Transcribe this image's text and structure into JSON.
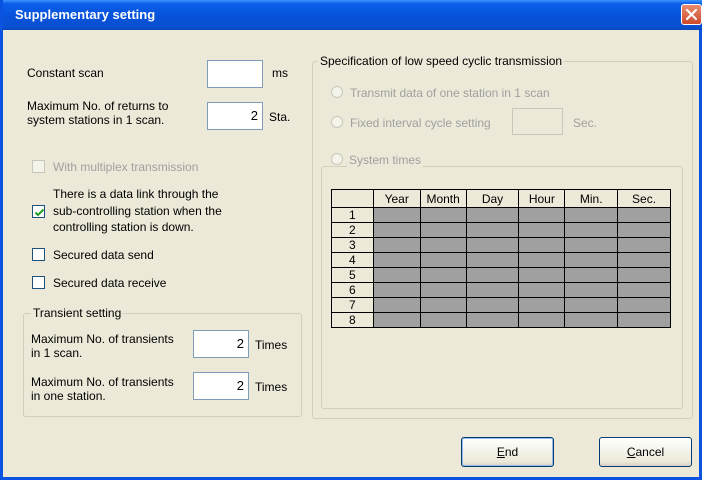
{
  "window": {
    "title": "Supplementary setting"
  },
  "constant_scan": {
    "label": "Constant scan",
    "value": "",
    "unit": "ms"
  },
  "max_returns": {
    "label_line1": "Maximum No. of returns to",
    "label_line2": "system stations in 1 scan.",
    "value": "2",
    "unit": "Sta."
  },
  "multiplex": {
    "label": "With multiplex transmission",
    "checked": false,
    "enabled": false
  },
  "data_link": {
    "label_line1": "There is a data link through the",
    "label_line2": "sub-controlling station when the",
    "label_line3": "controlling station is down.",
    "checked": true
  },
  "secured_send": {
    "label": "Secured data send",
    "checked": false
  },
  "secured_receive": {
    "label": "Secured data receive",
    "checked": false
  },
  "transient": {
    "group_title": "Transient setting",
    "per_scan": {
      "label_line1": "Maximum No. of transients",
      "label_line2": "in 1 scan.",
      "value": "2",
      "unit": "Times"
    },
    "per_station": {
      "label_line1": "Maximum No. of transients",
      "label_line2": "in one station.",
      "value": "2",
      "unit": "Times"
    }
  },
  "low_speed": {
    "group_title": "Specification of low speed cyclic transmission",
    "option1": "Transmit data of one station in 1 scan",
    "option2": "Fixed interval cycle setting",
    "option2_value": "",
    "option2_unit": "Sec.",
    "option3": "System times",
    "table": {
      "columns": [
        "",
        "Year",
        "Month",
        "Day",
        "Hour",
        "Min.",
        "Sec."
      ],
      "rows": [
        "1",
        "2",
        "3",
        "4",
        "5",
        "6",
        "7",
        "8"
      ]
    }
  },
  "buttons": {
    "end_accel": "E",
    "end_rest": "nd",
    "cancel_accel": "C",
    "cancel_rest": "ancel"
  }
}
